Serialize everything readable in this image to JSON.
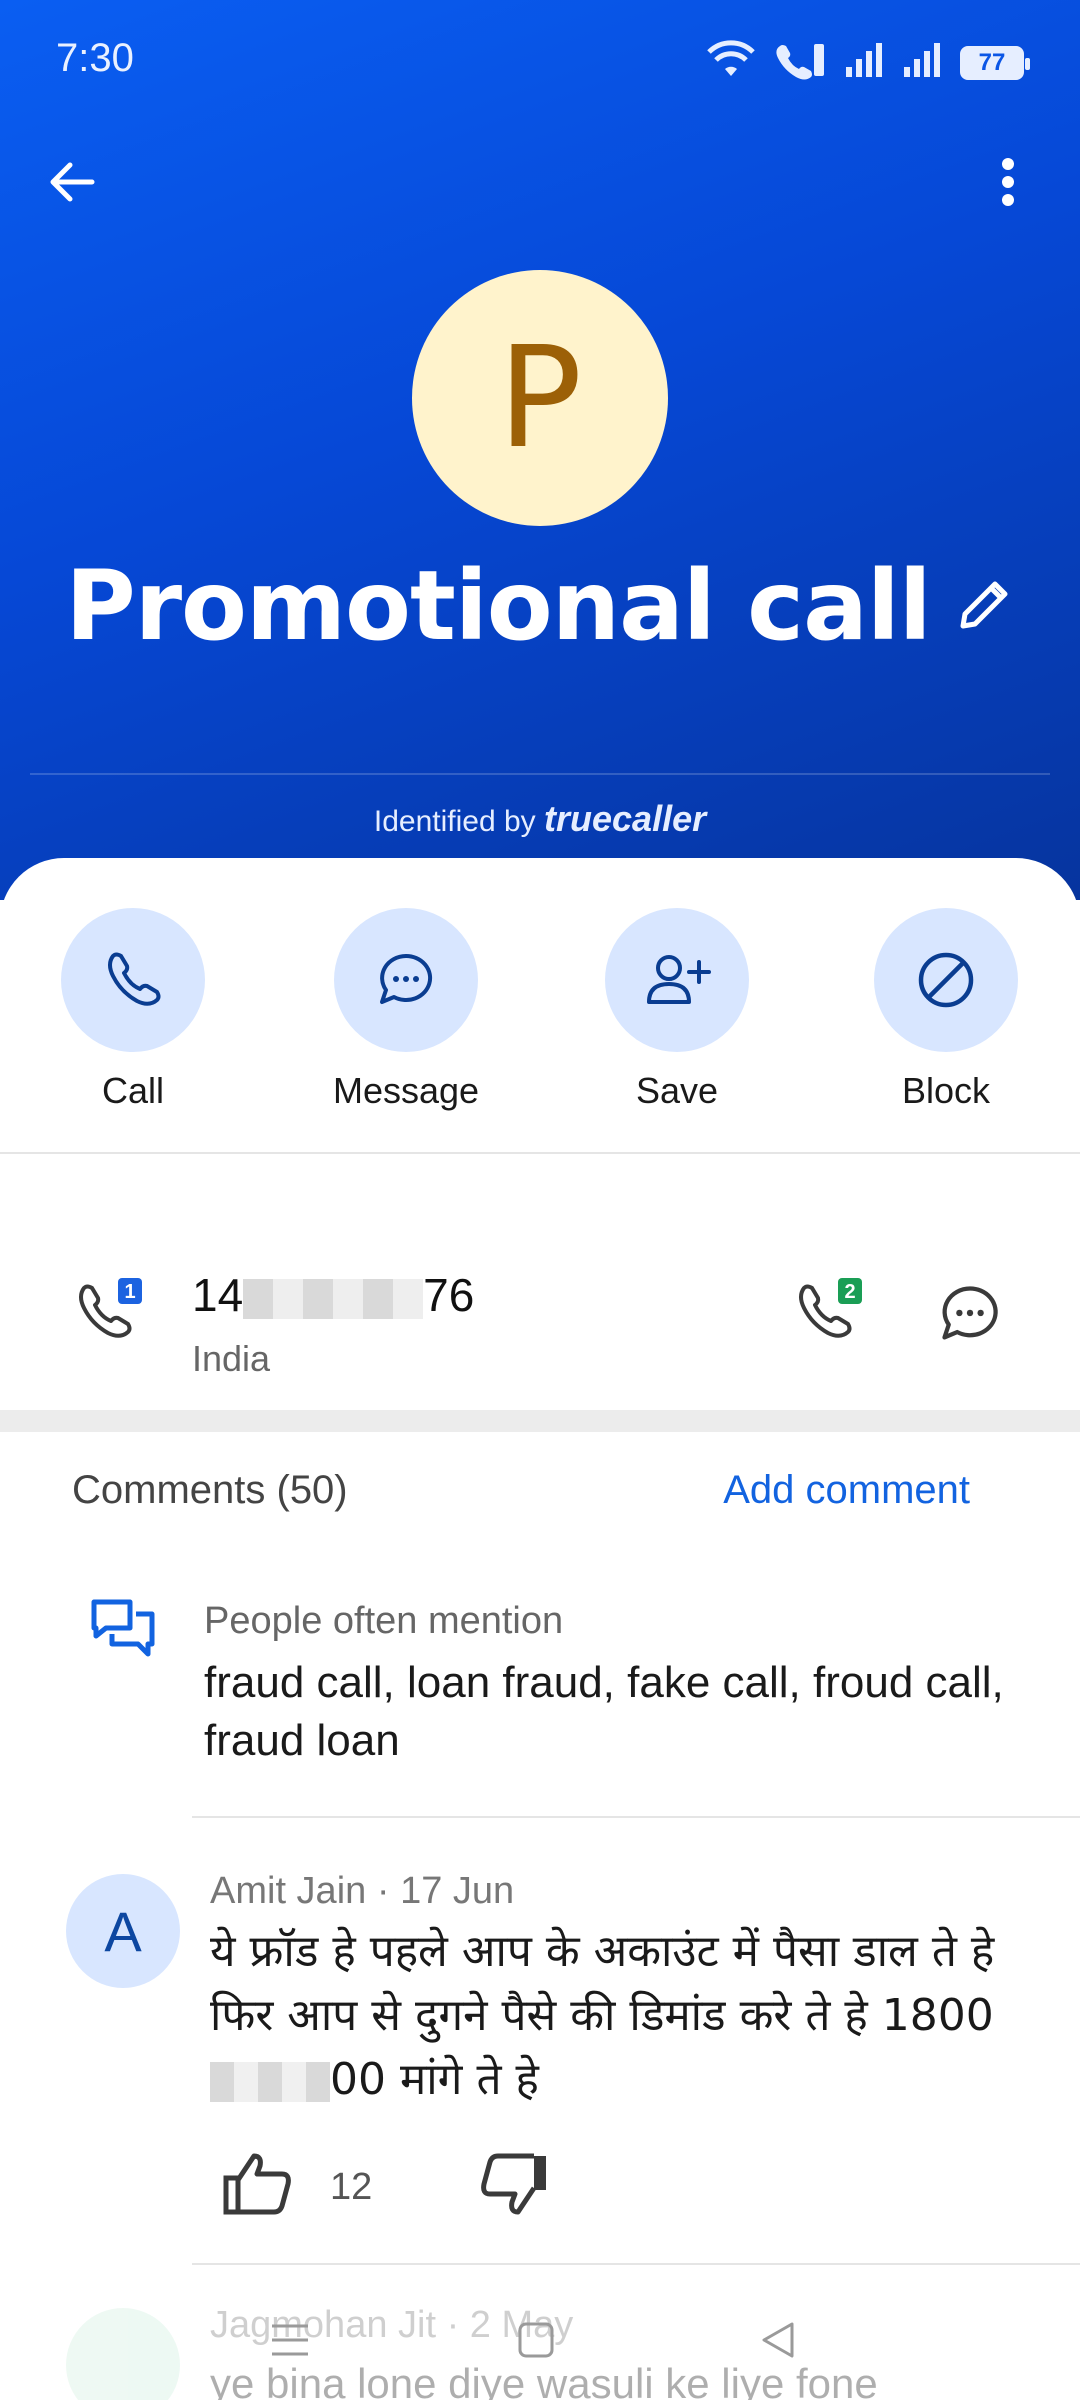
{
  "status": {
    "time": "7:30",
    "battery": "77"
  },
  "contact": {
    "initial": "P",
    "name": "Promotional call",
    "identified_prefix": "Identified by",
    "identified_brand": "truecaller"
  },
  "actions": [
    {
      "label": "Call",
      "icon": "phone-icon"
    },
    {
      "label": "Message",
      "icon": "message-icon"
    },
    {
      "label": "Save",
      "icon": "add-contact-icon"
    },
    {
      "label": "Block",
      "icon": "block-icon"
    }
  ],
  "phone": {
    "prefix": "14",
    "suffix": "76",
    "country": "India",
    "sim1_badge": "1",
    "sim2_badge": "2"
  },
  "comments": {
    "header": "Comments (50)",
    "add_label": "Add comment",
    "mention_label": "People often mention",
    "mention_tags": "fraud call, loan fraud, fake call, froud call, fraud loan",
    "items": [
      {
        "initial": "A",
        "author": "Amit Jain",
        "date": "17 Jun",
        "text_part1": "ये फ्रॉड हे पहले आप के अकाउंट में पैसा डाल ते हे फिर आप से दुगने पैसे की डिमांड करे ते हे 1800",
        "text_part2": "00 मांगे ते हे",
        "likes": "12"
      },
      {
        "author": "Jagmohan Jit",
        "date": "2 May",
        "text": "ye bina lone diye wasuli ke liye fone"
      }
    ]
  }
}
